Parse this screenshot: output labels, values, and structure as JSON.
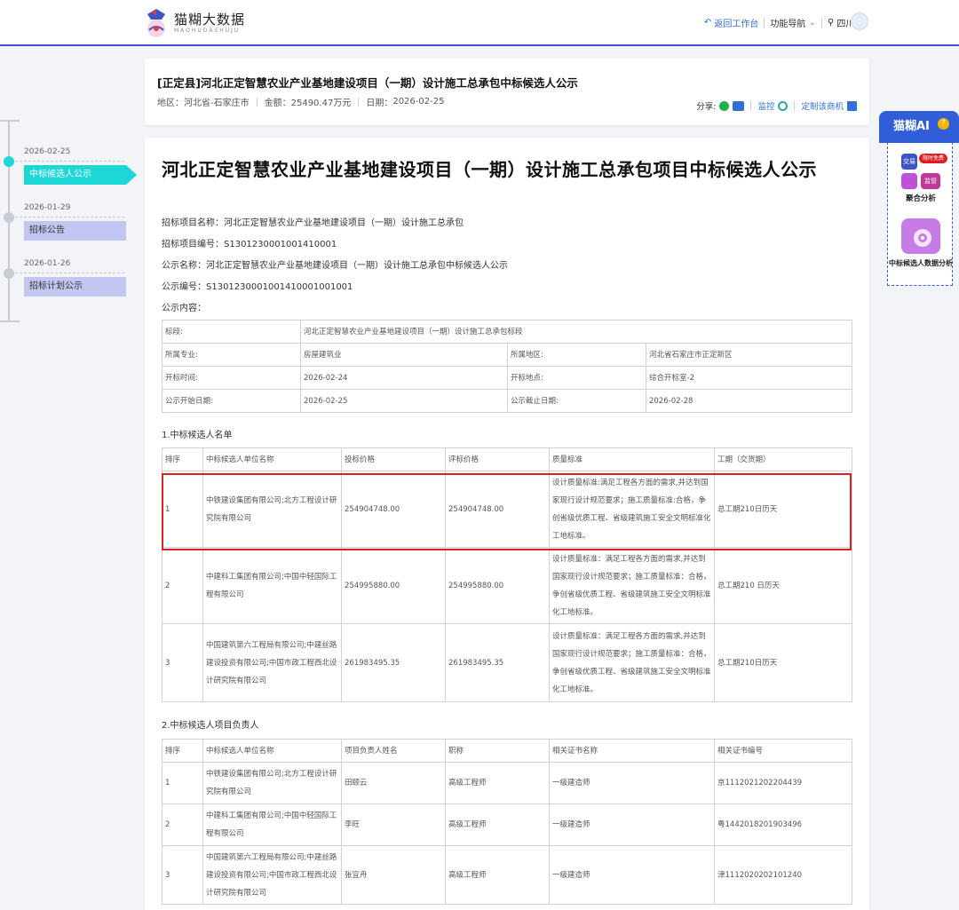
{
  "header": {
    "logo_name": "猫糊大数据",
    "logo_sub": "MAOHUDASHUJU",
    "back": "返回工作台",
    "nav": "功能导航",
    "region": "四川"
  },
  "summary": {
    "title": "[正定县]河北正定智慧农业产业基地建设项目（一期）设计施工总承包中标候选人公示",
    "region_label": "地区：",
    "region": "河北省-石家庄市",
    "amount_label": "金额：",
    "amount": "25490.47万元",
    "date_label": "日期：",
    "date": "2026-02-25",
    "share": "分享:",
    "monitor": "监控",
    "custom": "定制该商机"
  },
  "timeline": [
    {
      "date": "2026-02-25",
      "label": "中标候选人公示"
    },
    {
      "date": "2026-01-29",
      "label": "招标公告"
    },
    {
      "date": "2026-01-26",
      "label": "招标计划公示"
    }
  ],
  "doc": {
    "title": "河北正定智慧农业产业基地建设项目（一期）设计施工总承包项目中标候选人公示",
    "fields": [
      "招标项目名称：河北正定智慧农业产业基地建设项目（一期）设计施工总承包",
      "招标项目编号：S1301230001001410001",
      "公示名称：河北正定智慧农业产业基地建设项目（一期）设计施工总承包中标候选人公示",
      "公示编号：S1301230001001410001001001",
      "公示内容："
    ],
    "info": {
      "r0": [
        "标段:",
        "河北正定智慧农业产业基地建设项目（一期）设计施工总承包标段"
      ],
      "rows": [
        [
          "所属专业:",
          "房屋建筑业",
          "所属地区:",
          "河北省石家庄市正定新区"
        ],
        [
          "开标时间:",
          "2026-02-24",
          "开标地点:",
          "综合开标室-2"
        ],
        [
          "公示开始日期:",
          "2026-02-25",
          "公示截止日期:",
          "2026-02-28"
        ]
      ]
    },
    "sec1": "1.中标候选人名单",
    "t1": {
      "headers": [
        "排序",
        "中标候选人单位名称",
        "投标价格",
        "评标价格",
        "质量标准",
        "工期（交货期）"
      ],
      "rows": [
        [
          "1",
          "中铁建设集团有限公司;北方工程设计研究院有限公司",
          "254904748.00",
          "254904748.00",
          "设计质量标准:满足工程各方面的需求,并达到国家现行设计规范要求；施工质量标准:合格，争创省级优质工程、省级建筑施工安全文明标准化工地标准。",
          "总工期210日历天"
        ],
        [
          "2",
          "中建科工集团有限公司;中国中轻国际工程有限公司",
          "254995880.00",
          "254995880.00",
          "设计质量标准：满足工程各方面的需求,并达到国家现行设计规范要求；施工质量标准：合格，争创省级优质工程、省级建筑施工安全文明标准化工地标准。",
          "总工期210 日历天"
        ],
        [
          "3",
          "中国建筑第六工程局有限公司;中建丝路建设投资有限公司;中国市政工程西北设计研究院有限公司",
          "261983495.35",
          "261983495.35",
          "设计质量标准：满足工程各方面的需求,并达到国家现行设计规范要求；施工质量标准：合格，争创省级优质工程、省级建筑施工安全文明标准化工地标准。",
          "总工期210日历天"
        ]
      ]
    },
    "sec2": "2.中标候选人项目负责人",
    "t2": {
      "headers": [
        "排序",
        "中标候选人单位名称",
        "项目负责人姓名",
        "职称",
        "相关证书名称",
        "相关证书编号"
      ],
      "rows": [
        [
          "1",
          "中铁建设集团有限公司;北方工程设计研究院有限公司",
          "田颐云",
          "高级工程师",
          "一级建造师",
          "京1112021202204439"
        ],
        [
          "2",
          "中建科工集团有限公司;中国中轻国际工程有限公司",
          "李旺",
          "高级工程师",
          "一级建造师",
          "粤1442018201903496"
        ],
        [
          "3",
          "中国建筑第六工程局有限公司;中建丝路建设投资有限公司;中国市政工程西北设计研究院有限公司",
          "张宜舟",
          "高级工程师",
          "一级建造师",
          "津1112020202101240"
        ]
      ]
    }
  },
  "ai": {
    "title": "猫糊AI",
    "q": "?",
    "badge": "限时免费",
    "tag1": "交易",
    "tag2": "监管",
    "lbl1": "聚合分析",
    "lbl2": "中标候选人数据分析"
  }
}
